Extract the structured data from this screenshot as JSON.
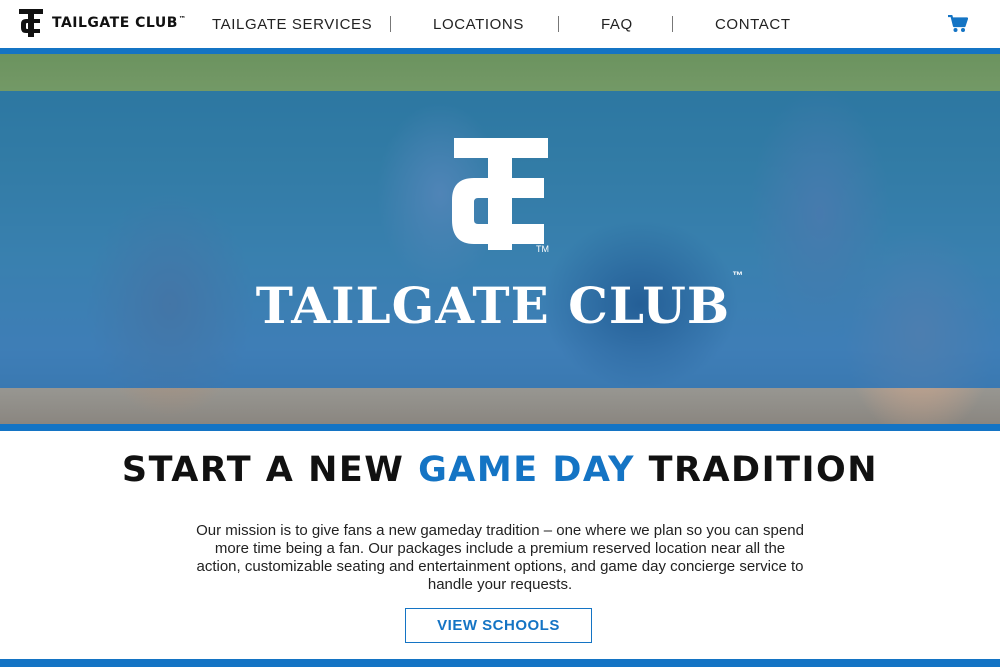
{
  "brand": {
    "name": "TAILGATE CLUB",
    "tm": "™"
  },
  "nav": {
    "items": [
      {
        "label": "TAILGATE SERVICES"
      },
      {
        "label": "LOCATIONS"
      },
      {
        "label": "FAQ"
      },
      {
        "label": "CONTACT"
      }
    ],
    "cart_icon": "shopping-cart-icon"
  },
  "hero": {
    "title": "TAILGATE CLUB",
    "tm": "™"
  },
  "headline": {
    "part1": "START A NEW ",
    "accent": "GAME DAY",
    "part2": " TRADITION"
  },
  "mission": "Our mission is to give fans a new gameday tradition – one where we plan so you can spend more time being a fan. Our packages include a premium reserved location near all the action, customizable seating and entertainment options, and game day concierge service to handle your requests.",
  "cta": {
    "label": "VIEW SCHOOLS"
  },
  "colors": {
    "accent": "#1474c4",
    "text": "#111111"
  }
}
